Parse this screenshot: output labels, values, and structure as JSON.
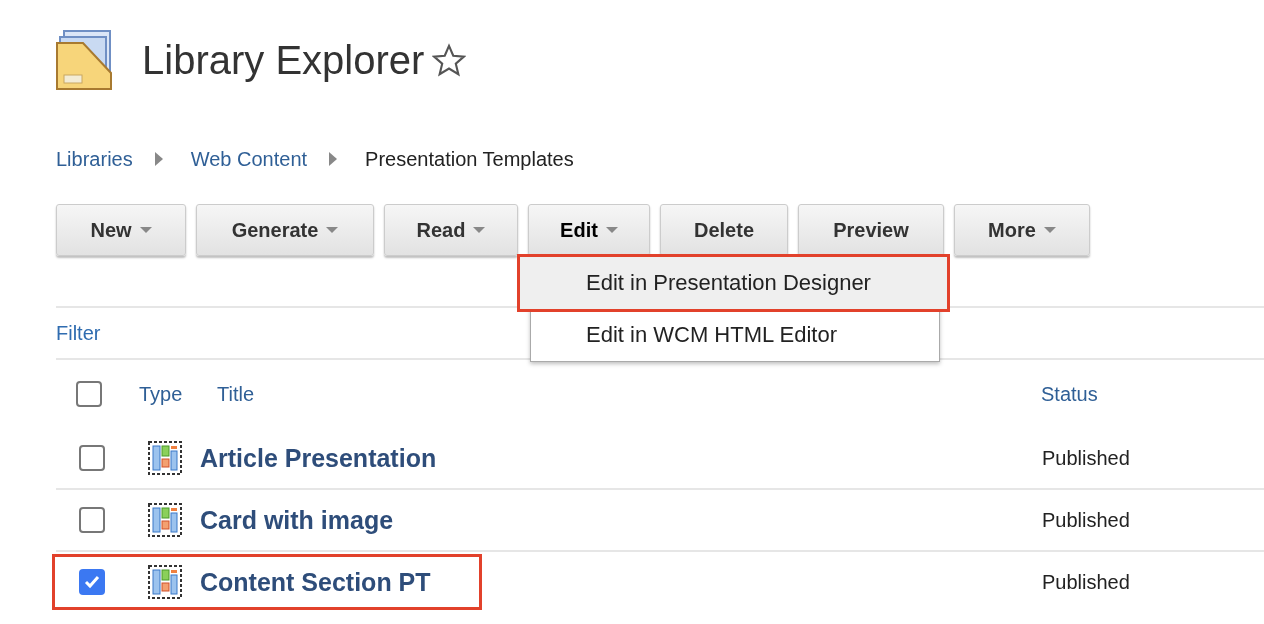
{
  "header": {
    "title": "Library Explorer",
    "favorite": false
  },
  "breadcrumb": [
    {
      "label": "Libraries",
      "link": true
    },
    {
      "label": "Web Content",
      "link": true
    },
    {
      "label": "Presentation Templates",
      "link": false
    }
  ],
  "toolbar": [
    {
      "label": "New",
      "has_menu": true
    },
    {
      "label": "Generate",
      "has_menu": true
    },
    {
      "label": "Read",
      "has_menu": true
    },
    {
      "label": "Edit",
      "has_menu": true,
      "expanded": true
    },
    {
      "label": "Delete",
      "has_menu": false
    },
    {
      "label": "Preview",
      "has_menu": false
    },
    {
      "label": "More",
      "has_menu": true
    }
  ],
  "edit_menu": [
    {
      "label": "Edit in Presentation Designer",
      "highlighted": true
    },
    {
      "label": "Edit in WCM HTML Editor",
      "highlighted": false
    }
  ],
  "filter": "Filter",
  "table": {
    "select_all_checked": false,
    "columns": [
      "Type",
      "Title",
      "Status"
    ],
    "rows": [
      {
        "title": "Article Presentation",
        "status": "Published",
        "checked": false,
        "highlighted": false
      },
      {
        "title": "Card with image",
        "status": "Published",
        "checked": false,
        "highlighted": false
      },
      {
        "title": "Content Section PT",
        "status": "Published",
        "checked": true,
        "highlighted": true
      }
    ]
  }
}
